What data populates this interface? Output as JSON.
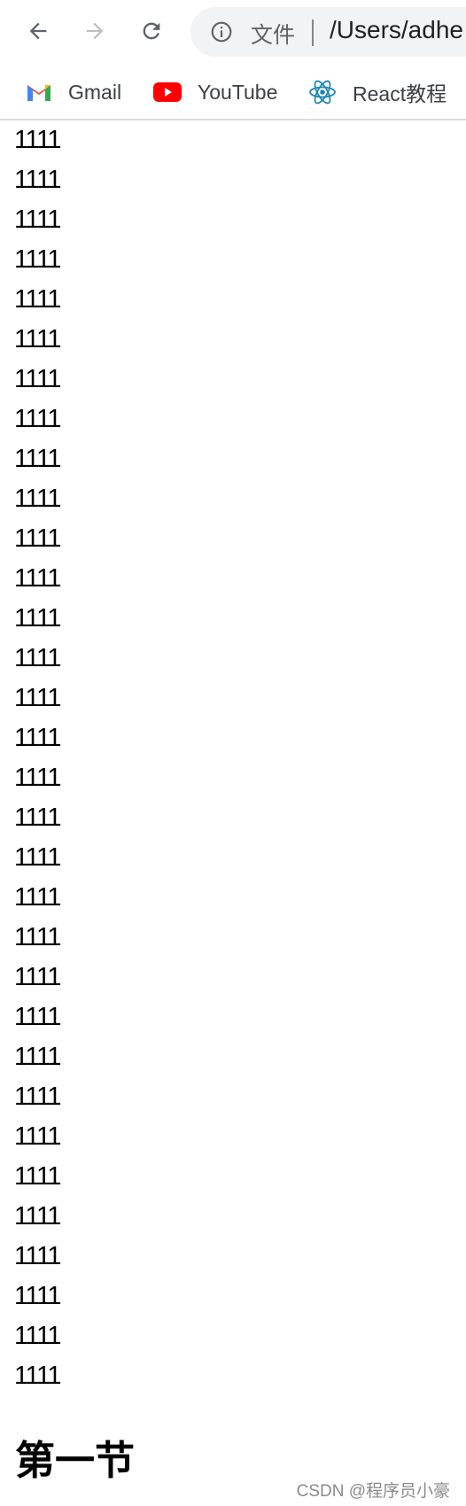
{
  "toolbar": {
    "back_icon": "arrow-left-icon",
    "forward_icon": "arrow-right-icon",
    "reload_icon": "reload-icon",
    "address": {
      "info_icon": "info-icon",
      "scheme_label": "文件",
      "url": "/Users/adhe"
    }
  },
  "bookmarks": [
    {
      "label": "Gmail",
      "icon": "gmail-icon"
    },
    {
      "label": "YouTube",
      "icon": "youtube-icon"
    },
    {
      "label": "React教程",
      "icon": "react-icon"
    }
  ],
  "content": {
    "lines": [
      "1111",
      "1111",
      "1111",
      "1111",
      "1111",
      "1111",
      "1111",
      "1111",
      "1111",
      "1111",
      "1111",
      "1111",
      "1111",
      "1111",
      "1111",
      "1111",
      "1111",
      "1111",
      "1111",
      "1111",
      "1111",
      "1111",
      "1111",
      "1111",
      "1111",
      "1111",
      "1111",
      "1111",
      "1111",
      "1111",
      "1111",
      "1111"
    ],
    "heading": "第一节"
  },
  "watermark": "CSDN @程序员小豪",
  "colors": {
    "omnibox_bg": "#f1f3f4",
    "youtube_red": "#ff0000",
    "react_blue": "#1f86b3"
  }
}
